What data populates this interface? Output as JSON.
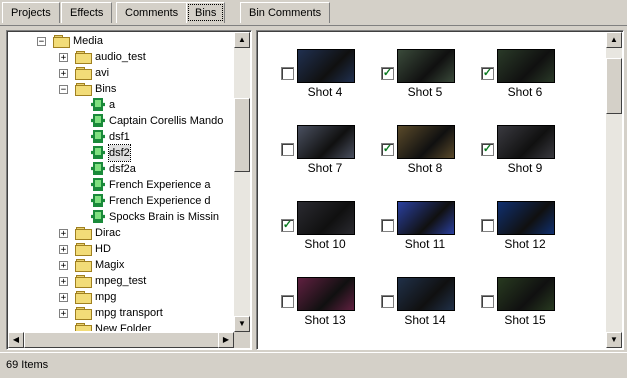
{
  "tabs": [
    {
      "label": "Projects"
    },
    {
      "label": "Effects"
    },
    {
      "label": "Comments"
    },
    {
      "label": "Bins"
    },
    {
      "label": "Bin Comments"
    }
  ],
  "tree": {
    "rows": [
      {
        "label": "Media",
        "type": "folder",
        "expander": "−"
      },
      {
        "label": "audio_test",
        "type": "folder",
        "expander": "+"
      },
      {
        "label": "avi",
        "type": "folder",
        "expander": "+"
      },
      {
        "label": "Bins",
        "type": "folder",
        "expander": "−"
      },
      {
        "label": "a",
        "type": "bin"
      },
      {
        "label": "Captain Corellis Mando",
        "type": "bin"
      },
      {
        "label": "dsf1",
        "type": "bin"
      },
      {
        "label": "dsf2",
        "type": "bin",
        "selected": true
      },
      {
        "label": "dsf2a",
        "type": "bin"
      },
      {
        "label": "French Experience a",
        "type": "bin"
      },
      {
        "label": "French Experience d",
        "type": "bin"
      },
      {
        "label": "Spocks Brain is Missin",
        "type": "bin"
      },
      {
        "label": "Dirac",
        "type": "folder",
        "expander": "+"
      },
      {
        "label": "HD",
        "type": "folder",
        "expander": "+"
      },
      {
        "label": "Magix",
        "type": "folder",
        "expander": "+"
      },
      {
        "label": "mpeg_test",
        "type": "folder",
        "expander": "+"
      },
      {
        "label": "mpg",
        "type": "folder",
        "expander": "+"
      },
      {
        "label": "mpg transport",
        "type": "folder",
        "expander": "+"
      },
      {
        "label": "New Folder",
        "type": "folder"
      }
    ]
  },
  "shots": [
    {
      "label": "Shot 4",
      "checked": false,
      "color": "#203050"
    },
    {
      "label": "Shot 5",
      "checked": true,
      "color": "#3a4a3a"
    },
    {
      "label": "Shot 6",
      "checked": true,
      "color": "#2a3a28"
    },
    {
      "label": "Shot 7",
      "checked": false,
      "color": "#4a5060"
    },
    {
      "label": "Shot 8",
      "checked": true,
      "color": "#5a4a2a"
    },
    {
      "label": "Shot 9",
      "checked": true,
      "color": "#3a3a40"
    },
    {
      "label": "Shot 10",
      "checked": true,
      "color": "#2a2a30"
    },
    {
      "label": "Shot 11",
      "checked": false,
      "color": "#2a40a0"
    },
    {
      "label": "Shot 12",
      "checked": false,
      "color": "#103070"
    },
    {
      "label": "Shot 13",
      "checked": false,
      "color": "#602040"
    },
    {
      "label": "Shot 14",
      "checked": false,
      "color": "#203048"
    },
    {
      "label": "Shot 15",
      "checked": false,
      "color": "#283a20"
    }
  ],
  "status": {
    "text": "69 Items"
  }
}
